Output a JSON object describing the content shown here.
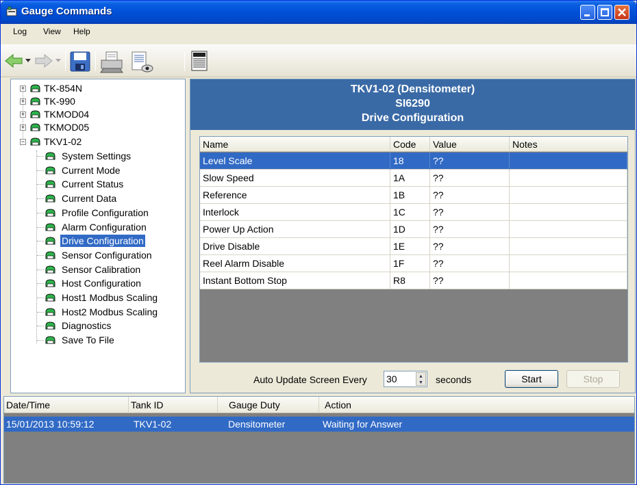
{
  "window": {
    "title": "Gauge Commands"
  },
  "menu": {
    "items": [
      "Log",
      "View",
      "Help"
    ]
  },
  "toolbar": {
    "icons": [
      "back-arrow-icon",
      "dropdown-icon",
      "forward-arrow-icon",
      "dropdown-icon",
      "save-icon",
      "print-icon",
      "print-preview-icon",
      "grid-view-icon"
    ]
  },
  "tree": {
    "roots": [
      "TK-854N",
      "TK-990",
      "TKMOD04",
      "TKMOD05",
      "TKV1-02"
    ],
    "children": [
      "System Settings",
      "Current Mode",
      "Current Status",
      "Current Data",
      "Profile Configuration",
      "Alarm Configuration",
      "Drive Configuration",
      "Sensor Configuration",
      "Sensor Calibration",
      "Host Configuration",
      "Host1 Modbus Scaling",
      "Host2 Modbus Scaling",
      "Diagnostics",
      "Save To File"
    ],
    "selected_child": "Drive Configuration"
  },
  "panel": {
    "line1": "TKV1-02 (Densitometer)",
    "line2": "SI6290",
    "line3": "Drive Configuration"
  },
  "grid": {
    "columns": [
      "Name",
      "Code",
      "Value",
      "Notes"
    ],
    "rows": [
      {
        "name": "Level Scale",
        "code": "18",
        "value": "??",
        "notes": ""
      },
      {
        "name": "Slow Speed",
        "code": "1A",
        "value": "??",
        "notes": ""
      },
      {
        "name": "Reference",
        "code": "1B",
        "value": "??",
        "notes": ""
      },
      {
        "name": "Interlock",
        "code": "1C",
        "value": "??",
        "notes": ""
      },
      {
        "name": "Power Up Action",
        "code": "1D",
        "value": "??",
        "notes": ""
      },
      {
        "name": "Drive Disable",
        "code": "1E",
        "value": "??",
        "notes": ""
      },
      {
        "name": "Reel Alarm Disable",
        "code": "1F",
        "value": "??",
        "notes": ""
      },
      {
        "name": "Instant Bottom Stop",
        "code": "R8",
        "value": "??",
        "notes": ""
      }
    ]
  },
  "auto_update": {
    "label": "Auto Update Screen Every",
    "value": "30",
    "unit": "seconds",
    "start_label": "Start",
    "stop_label": "Stop"
  },
  "log": {
    "columns": [
      "Date/Time",
      "Tank ID",
      "Gauge Duty",
      "Action"
    ],
    "rows": [
      {
        "datetime": "15/01/2013 10:59:12",
        "tank": "TKV1-02",
        "duty": "Densitometer",
        "action": "Waiting for Answer"
      }
    ]
  },
  "colors": {
    "selection": "#316ac5",
    "header_band": "#3a6aa6",
    "titlebar": "#0050d8",
    "node_icon": "#22b14c"
  }
}
